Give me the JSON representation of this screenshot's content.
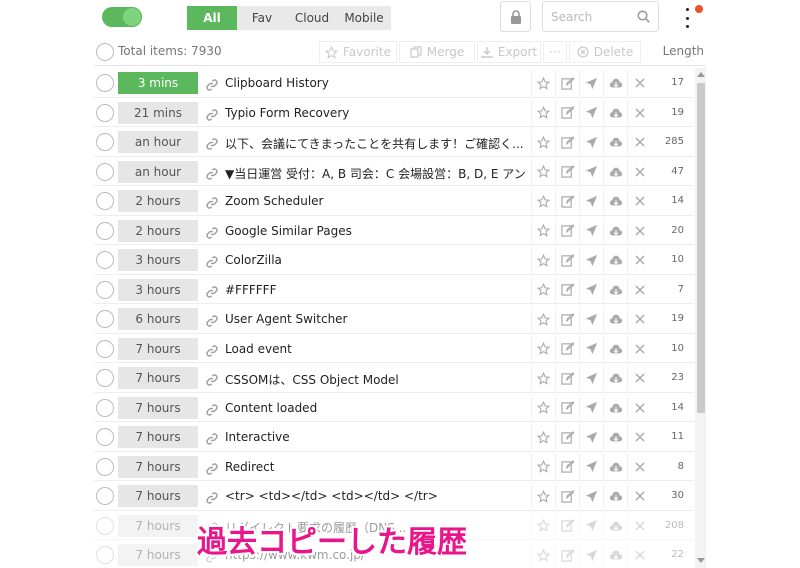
{
  "tabs": [
    {
      "label": "All",
      "active": true
    },
    {
      "label": "Fav",
      "active": false
    },
    {
      "label": "Cloud",
      "active": false
    },
    {
      "label": "Mobile",
      "active": false
    }
  ],
  "search": {
    "placeholder": "Search"
  },
  "toolbar": {
    "total": "Total items: 7930",
    "favorite": "Favorite",
    "merge": "Merge",
    "export": "Export",
    "more": "···",
    "delete": "Delete",
    "length_header": "Length"
  },
  "rows": [
    {
      "time": "3 mins",
      "title": "Clipboard History",
      "length": "17",
      "recent": true
    },
    {
      "time": "21 mins",
      "title": "Typio Form Recovery",
      "length": "19"
    },
    {
      "time": "an hour",
      "title": "以下、会議にてきまったことを共有します！ご確認く...",
      "length": "285"
    },
    {
      "time": "an hour",
      "title": "▼当日運営 受付：A, B 司会：C 会場設営：B, D, E アンケ...",
      "length": "47"
    },
    {
      "time": "2 hours",
      "title": "Zoom Scheduler",
      "length": "14"
    },
    {
      "time": "2 hours",
      "title": "Google Similar Pages",
      "length": "20"
    },
    {
      "time": "3 hours",
      "title": "ColorZilla",
      "length": "10"
    },
    {
      "time": "3 hours",
      "title": "#FFFFFF",
      "length": "7"
    },
    {
      "time": "6 hours",
      "title": "User Agent Switcher",
      "length": "19"
    },
    {
      "time": "7 hours",
      "title": "Load event",
      "length": "10"
    },
    {
      "time": "7 hours",
      "title": "CSSOMは、CSS Object Model",
      "length": "23"
    },
    {
      "time": "7 hours",
      "title": "Content loaded",
      "length": "14"
    },
    {
      "time": "7 hours",
      "title": "Interactive",
      "length": "11"
    },
    {
      "time": "7 hours",
      "title": "Redirect",
      "length": "8"
    },
    {
      "time": "7 hours",
      "title": "<tr> <td></td> <td></td> </tr>",
      "length": "30"
    },
    {
      "time": "7 hours",
      "title": "リダイレクト要求の履歴（DNS...",
      "length": "208"
    },
    {
      "time": "7 hours",
      "title": "https://www.kwm.co.jp/",
      "length": "22"
    }
  ],
  "caption": "過去コピーした履歴",
  "colors": {
    "accent": "#5cb85c",
    "caption": "#e8168a",
    "notification": "#f0502c"
  }
}
